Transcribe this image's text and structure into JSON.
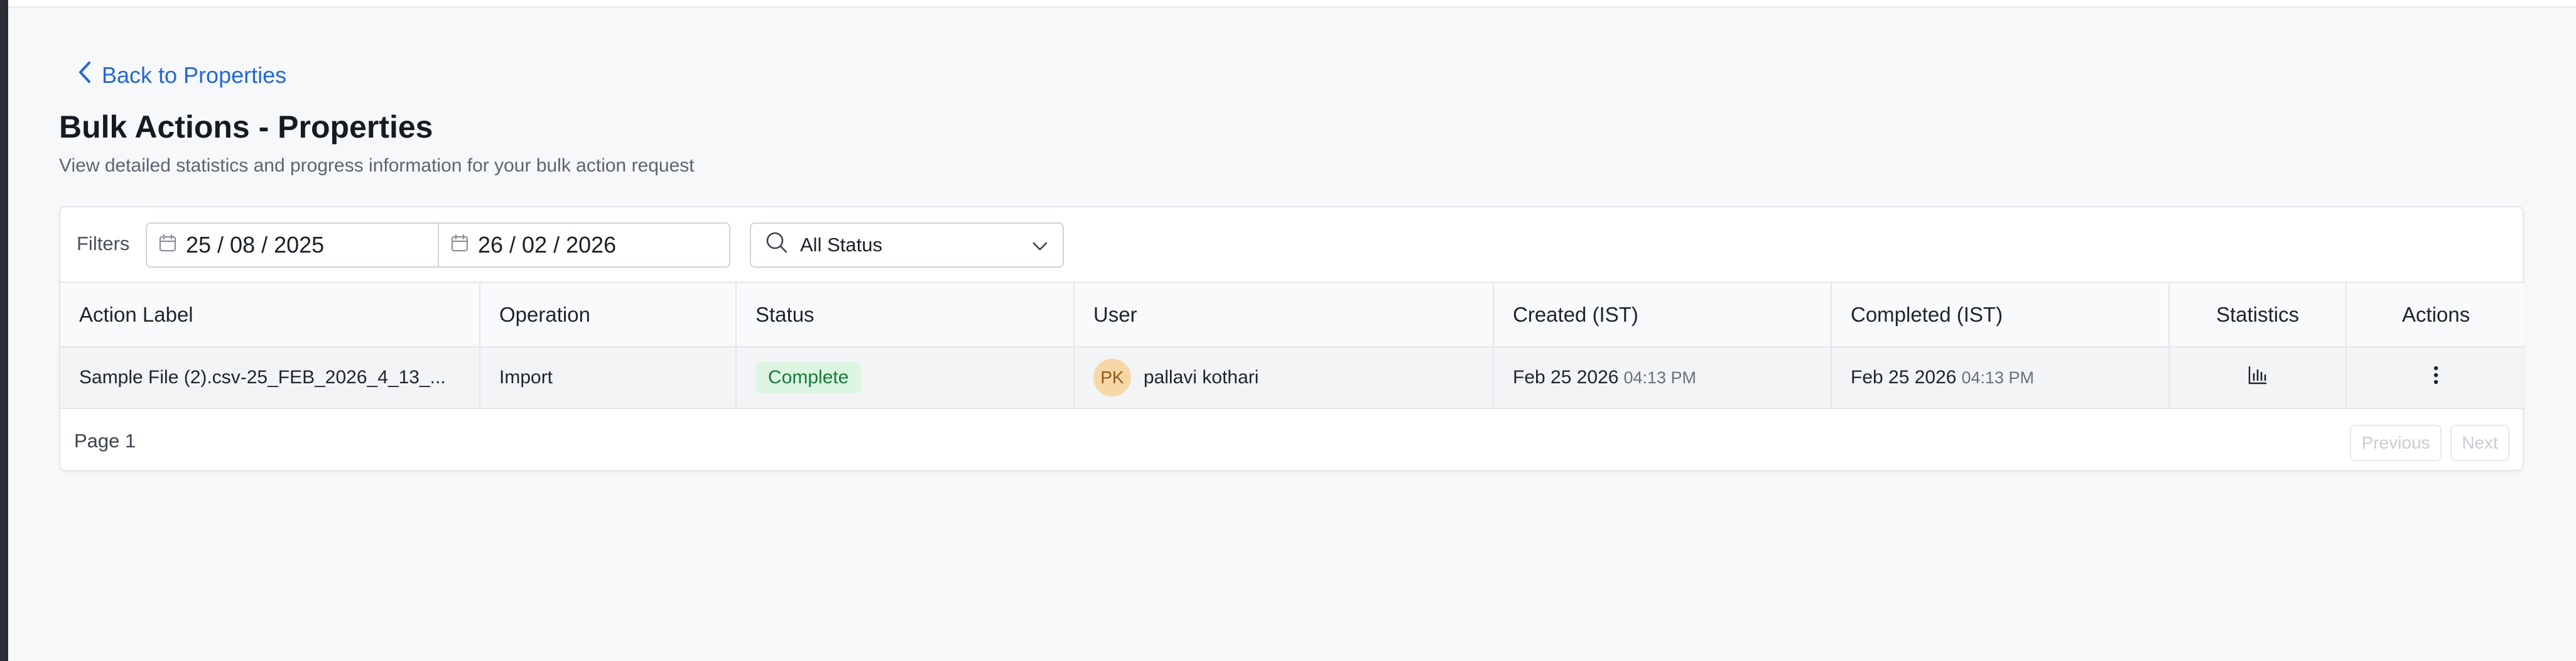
{
  "back_link": {
    "label": "Back to Properties"
  },
  "page": {
    "title": "Bulk Actions - Properties",
    "subtitle": "View detailed statistics and progress information for your bulk action request"
  },
  "filters": {
    "label": "Filters",
    "start_date": "25 / 08 / 2025",
    "end_date": "26 / 02 / 2026",
    "status_value": "All Status"
  },
  "table": {
    "columns": [
      "Action Label",
      "Operation",
      "Status",
      "User",
      "Created (IST)",
      "Completed (IST)",
      "Statistics",
      "Actions"
    ],
    "rows": [
      {
        "action_label": "Sample File (2).csv-25_FEB_2026_4_13_...",
        "operation": "Import",
        "status": "Complete",
        "user_initials": "PK",
        "user_name": "pallavi kothari",
        "created_date": "Feb 25 2026",
        "created_time": "04:13 PM",
        "completed_date": "Feb 25 2026",
        "completed_time": "04:13 PM"
      }
    ]
  },
  "pagination": {
    "page_label": "Page 1",
    "previous_label": "Previous",
    "next_label": "Next"
  },
  "icons": {
    "back": "chevron-left-icon",
    "calendar": "calendar-icon",
    "search": "search-icon",
    "dropdown": "chevron-down-icon",
    "statistics": "bar-chart-icon",
    "actions": "more-vertical-icon"
  },
  "colors": {
    "accent": "#2467d6",
    "status_complete_bg": "#dcf5e2",
    "status_complete_text": "#177a3a",
    "avatar_bg": "#f8d7a6"
  }
}
